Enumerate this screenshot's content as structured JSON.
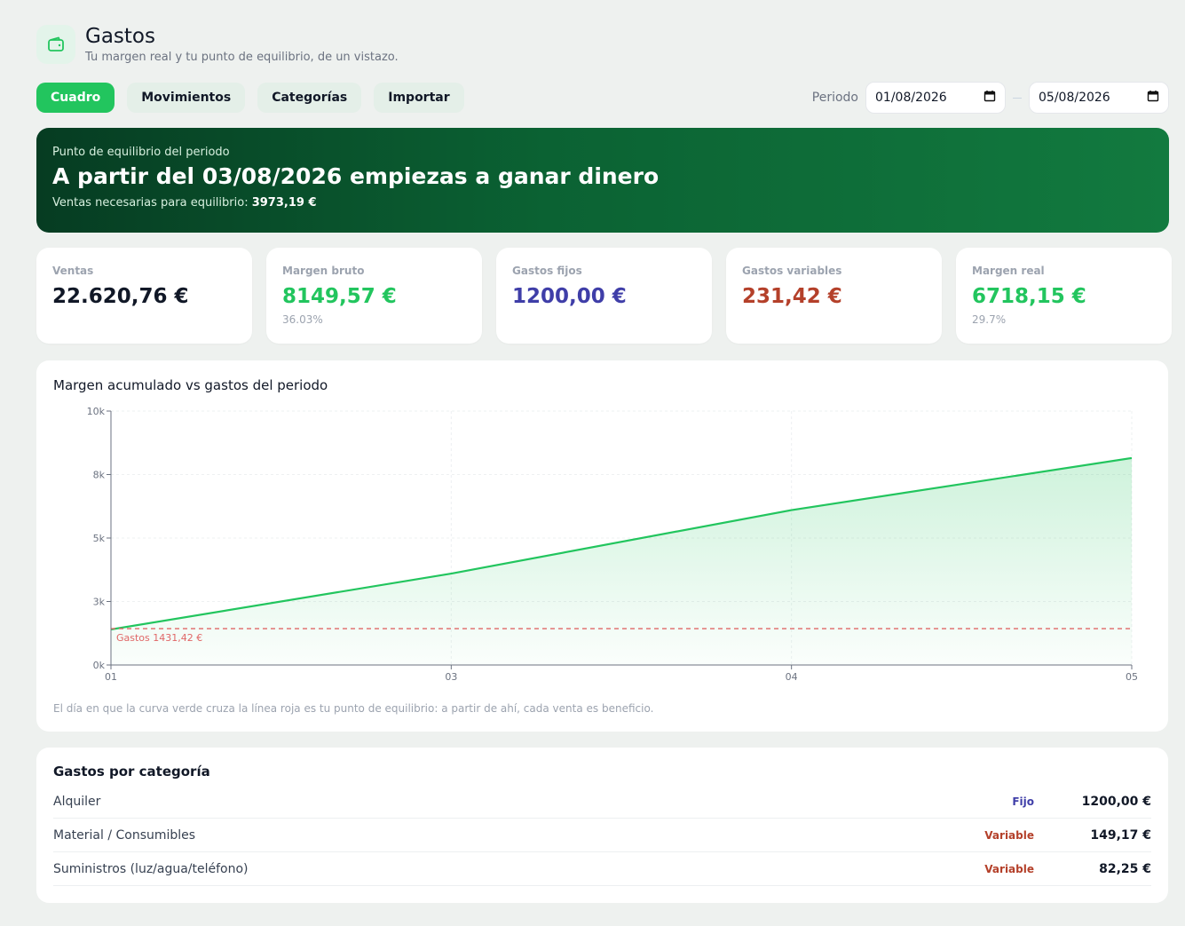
{
  "header": {
    "title": "Gastos",
    "subtitle": "Tu margen real y tu punto de equilibrio, de un vistazo.",
    "icon": "wallet-icon"
  },
  "tabs": [
    {
      "label": "Cuadro",
      "active": true
    },
    {
      "label": "Movimientos",
      "active": false
    },
    {
      "label": "Categorías",
      "active": false
    },
    {
      "label": "Importar",
      "active": false
    }
  ],
  "period": {
    "label": "Periodo",
    "from": "01/08/2026",
    "to": "05/08/2026"
  },
  "hero": {
    "label": "Punto de equilibrio del periodo",
    "title": "A partir del 03/08/2026 empiezas a ganar dinero",
    "sub_label": "Ventas necesarias para equilibrio:",
    "sub_value": "3973,19 €"
  },
  "kpis": [
    {
      "label": "Ventas",
      "value": "22.620,76 €",
      "pct": "",
      "color": "#111827"
    },
    {
      "label": "Margen bruto",
      "value": "8149,57 €",
      "pct": "36.03%",
      "color": "#22c55e"
    },
    {
      "label": "Gastos fijos",
      "value": "1200,00 €",
      "pct": "",
      "color": "#3f3ea8"
    },
    {
      "label": "Gastos variables",
      "value": "231,42 €",
      "pct": "",
      "color": "#b4402a"
    },
    {
      "label": "Margen real",
      "value": "6718,15 €",
      "pct": "29.7%",
      "color": "#22c55e"
    }
  ],
  "chart": {
    "title": "Margen acumulado vs gastos del periodo",
    "note": "El día en que la curva verde cruza la línea roja es tu punto de equilibrio: a partir de ahí, cada venta es beneficio.",
    "expense_label": "Gastos 1431,42 €"
  },
  "chart_data": {
    "type": "area",
    "x": [
      "01",
      "03",
      "04",
      "05"
    ],
    "series": [
      {
        "values": [
          1400,
          3600,
          6100,
          8150
        ],
        "color": "#22c55e"
      }
    ],
    "threshold": {
      "label": "Gastos 1431,42 €",
      "value": 1431.42,
      "color": "#e06666"
    },
    "yticks": [
      "0k",
      "3k",
      "5k",
      "8k",
      "10k"
    ],
    "ytick_values": [
      0,
      2500,
      5000,
      7500,
      10000
    ],
    "ylim": [
      0,
      10000
    ],
    "grid": true
  },
  "categories": {
    "title": "Gastos por categoría",
    "rows": [
      {
        "name": "Alquiler",
        "type": "Fijo",
        "amount": "1200,00 €",
        "type_color": "#3f3ea8"
      },
      {
        "name": "Material / Consumibles",
        "type": "Variable",
        "amount": "149,17 €",
        "type_color": "#b4402a"
      },
      {
        "name": "Suministros (luz/agua/teléfono)",
        "type": "Variable",
        "amount": "82,25 €",
        "type_color": "#b4402a"
      }
    ]
  }
}
